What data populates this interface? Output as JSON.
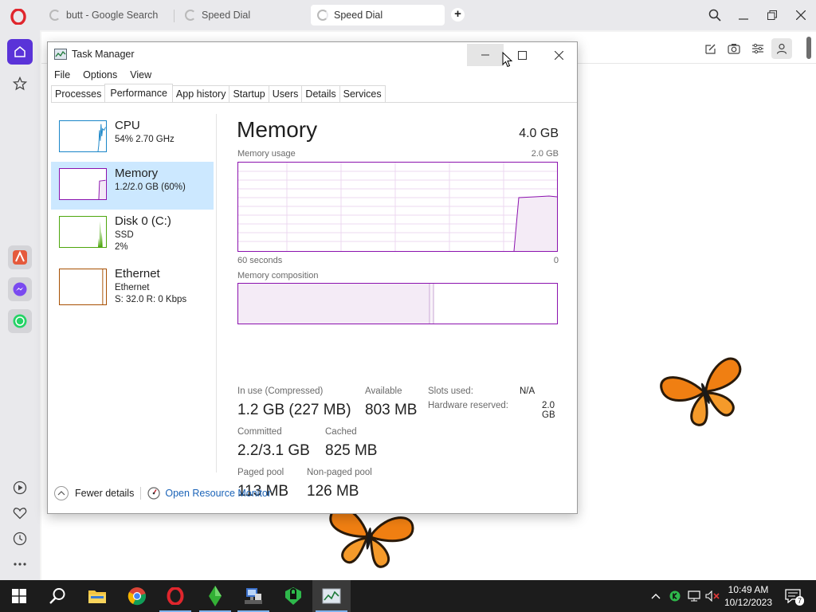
{
  "browser": {
    "tabs": [
      {
        "label": "butt - Google Search"
      },
      {
        "label": "Speed Dial"
      },
      {
        "label": "Speed Dial"
      }
    ]
  },
  "task_manager": {
    "title": "Task Manager",
    "menu": [
      "File",
      "Options",
      "View"
    ],
    "tabs": [
      "Processes",
      "Performance",
      "App history",
      "Startup",
      "Users",
      "Details",
      "Services"
    ],
    "active_tab": "Performance",
    "sidebar": [
      {
        "title": "CPU",
        "line1": "54%  2.70 GHz",
        "line2": ""
      },
      {
        "title": "Memory",
        "line1": "1.2/2.0 GB (60%)",
        "line2": ""
      },
      {
        "title": "Disk 0 (C:)",
        "line1": "SSD",
        "line2": "2%"
      },
      {
        "title": "Ethernet",
        "line1": "Ethernet",
        "line2": "S: 32.0  R: 0 Kbps"
      }
    ],
    "memory": {
      "heading": "Memory",
      "total": "4.0 GB",
      "usage_label": "Memory usage",
      "usage_max": "2.0 GB",
      "x_start": "60 seconds",
      "x_end": "0",
      "composition_label": "Memory composition",
      "in_use_label": "In use (Compressed)",
      "in_use_value": "1.2 GB (227 MB)",
      "available_label": "Available",
      "available_value": "803 MB",
      "slots_label": "Slots used:",
      "slots_value": "N/A",
      "hw_label": "Hardware reserved:",
      "hw_value": "2.0 GB",
      "committed_label": "Committed",
      "committed_value": "2.2/3.1 GB",
      "cached_label": "Cached",
      "cached_value": "825 MB",
      "paged_label": "Paged pool",
      "paged_value": "113 MB",
      "nonpaged_label": "Non-paged pool",
      "nonpaged_value": "126 MB",
      "usage_fraction": 0.6,
      "in_use_fraction": 0.6
    },
    "footer": {
      "fewer_details": "Fewer details",
      "resource_monitor": "Open Resource Monitor"
    }
  },
  "taskbar": {
    "time": "10:49 AM",
    "date": "10/12/2023",
    "notification_count": "7"
  },
  "colors": {
    "memory_accent": "#8b12ae",
    "selection": "#cce8ff",
    "opera_red": "#e0262d",
    "home_button": "#5a33d8"
  }
}
